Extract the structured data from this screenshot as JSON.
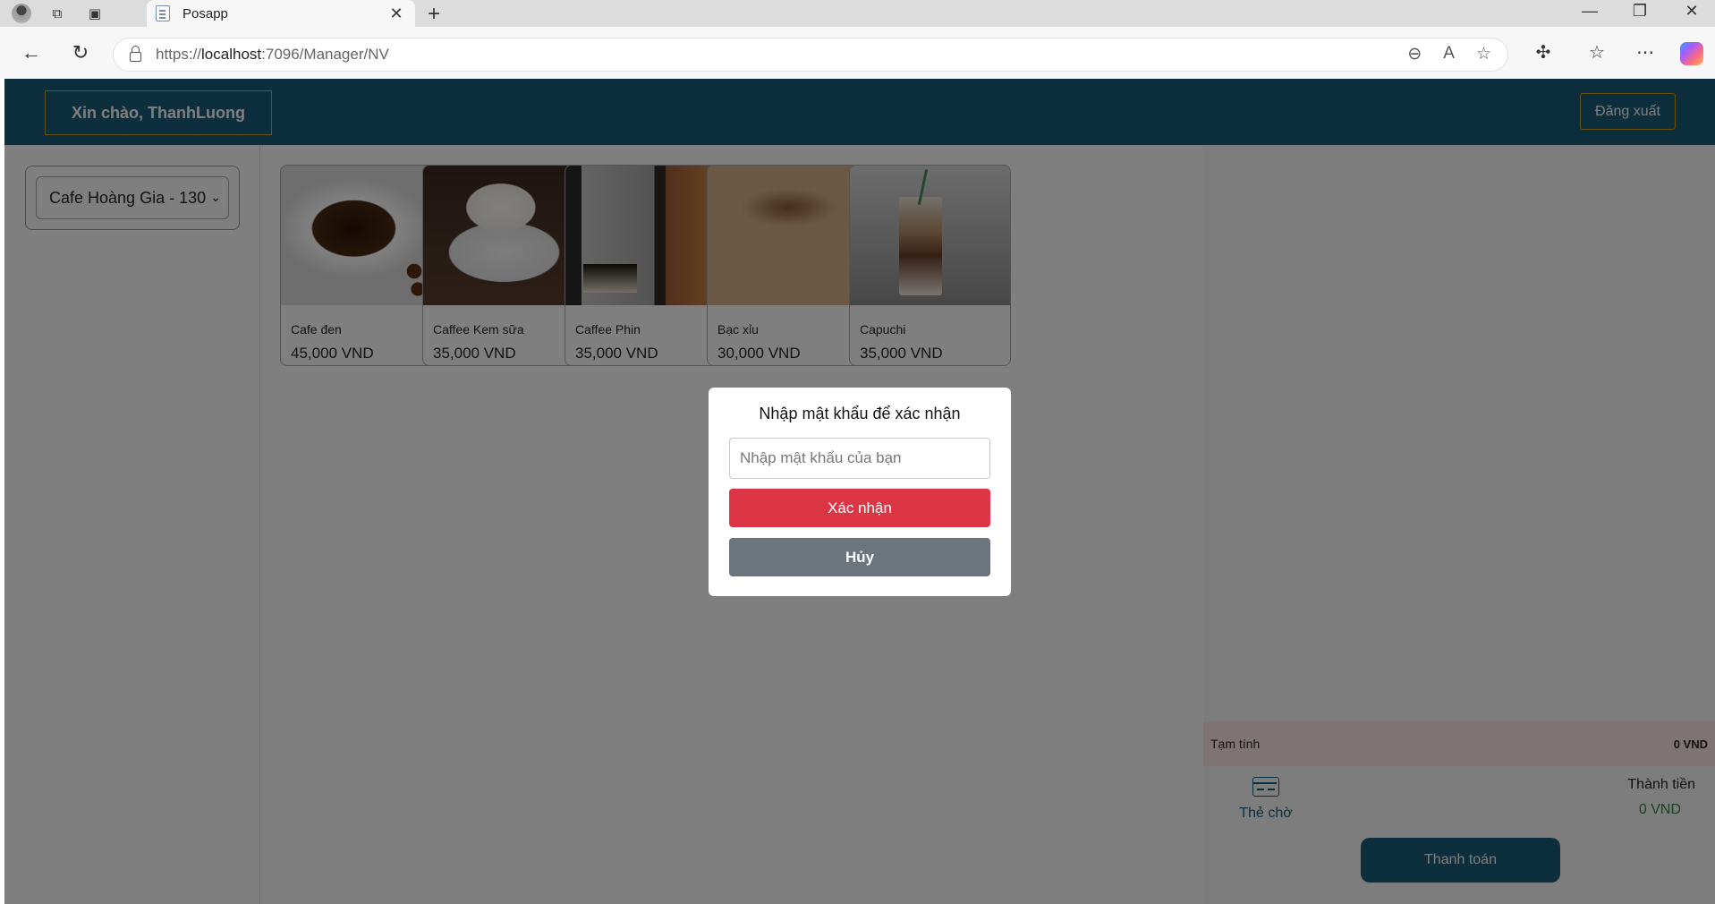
{
  "browser": {
    "tab_title": "Posapp",
    "url_prefix": "https://",
    "url_host": "localhost",
    "url_path": ":7096/Manager/NV"
  },
  "header": {
    "greeting": "Xin chào, ThanhLuong",
    "logout_label": "Đăng xuất"
  },
  "sidebar": {
    "store_selected": "Cafe Hoàng Gia - 130"
  },
  "products": [
    {
      "name": "Cafe đen",
      "price": "45,000 VND"
    },
    {
      "name": "Caffee Kem sữa",
      "price": "35,000 VND"
    },
    {
      "name": "Caffee Phin",
      "price": "35,000 VND"
    },
    {
      "name": "Bạc xỉu",
      "price": "30,000 VND"
    },
    {
      "name": "Capuchi",
      "price": "35,000 VND"
    }
  ],
  "cart": {
    "subtotal_label": "Tạm tính",
    "subtotal_value": "0 VND",
    "hold_label": "Thẻ chờ",
    "total_label": "Thành tiền",
    "total_value": "0 VND",
    "pay_label": "Thanh toán"
  },
  "modal": {
    "title": "Nhập mật khẩu để xác nhận",
    "password_placeholder": "Nhập mật khẩu của bạn",
    "password_value": "",
    "confirm_label": "Xác nhận",
    "cancel_label": "Hủy"
  },
  "colors": {
    "header_bg": "#1a5f7a",
    "accent_border": "#c9a227",
    "confirm_bg": "#dc3545",
    "cancel_bg": "#6c757d",
    "total_value": "#2e8b3e"
  }
}
